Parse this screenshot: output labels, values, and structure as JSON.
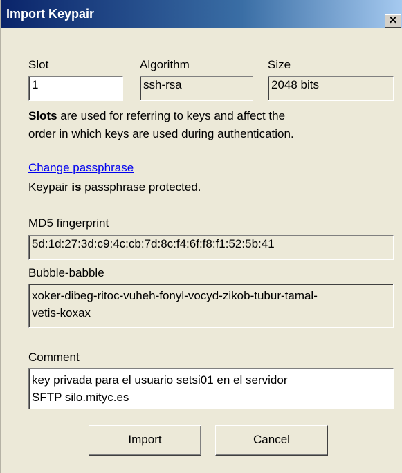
{
  "window": {
    "title": "Import Keypair",
    "close_glyph": "✕"
  },
  "slot": {
    "label": "Slot",
    "value": "1"
  },
  "algorithm": {
    "label": "Algorithm",
    "value": "ssh-rsa"
  },
  "size": {
    "label": "Size",
    "value": "2048 bits"
  },
  "slots_note": {
    "bold": "Slots",
    "line1_rest": " are used for referring to keys and affect the",
    "line2": "order in which keys are used during authentication."
  },
  "passphrase": {
    "link": "Change passphrase",
    "status_pre": "Keypair ",
    "status_bold": "is",
    "status_post": " passphrase protected."
  },
  "md5": {
    "label": "MD5 fingerprint",
    "value": "5d:1d:27:3d:c9:4c:cb:7d:8c:f4:6f:f8:f1:52:5b:41"
  },
  "bubble_babble": {
    "label": "Bubble-babble",
    "line1": "xoker-dibeg-ritoc-vuheh-fonyl-vocyd-zikob-tubur-tamal-",
    "line2": "vetis-koxax"
  },
  "comment": {
    "label": "Comment",
    "line1": "key privada para el usuario setsi01 en el servidor",
    "line2": "SFTP silo.mityc.es"
  },
  "buttons": {
    "import": "Import",
    "cancel": "Cancel"
  }
}
